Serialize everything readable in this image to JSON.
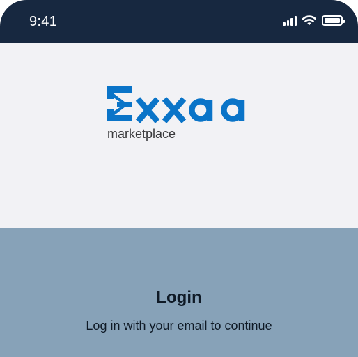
{
  "status_bar": {
    "time": "9:41",
    "icons": [
      "signal-icon",
      "wifi-icon",
      "battery-icon"
    ]
  },
  "brand": {
    "logo_text": "Exxaa",
    "tagline": "marketplace",
    "color": "#0a74c8"
  },
  "login": {
    "title": "Login",
    "subtitle": "Log in with your email to continue"
  },
  "colors": {
    "status_bar_bg": "#172840",
    "page_bg": "#f2f2f5",
    "panel_bg": "#87a2b8"
  }
}
